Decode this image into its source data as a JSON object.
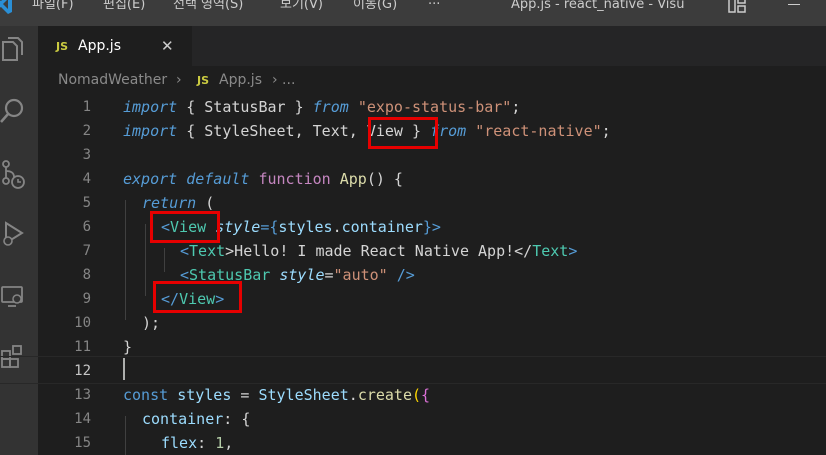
{
  "menu": {
    "items": [
      "파일(F)",
      "편집(E)",
      "선택 영역(S)",
      "보기(V)",
      "이동(G)"
    ],
    "more": "···"
  },
  "window": {
    "title": "App.js - react_native - Visu"
  },
  "tab": {
    "badge": "JS",
    "label": "App.js",
    "close": "✕"
  },
  "breadcrumb": {
    "folder": "NomadWeather",
    "sep": "›",
    "badge": "JS",
    "file": "App.js",
    "tail": "› ..."
  },
  "colors": {
    "highlight": "#e60000",
    "background": "#1e1e1e"
  },
  "lines": [
    {
      "n": "1"
    },
    {
      "n": "2"
    },
    {
      "n": "3"
    },
    {
      "n": "4"
    },
    {
      "n": "5"
    },
    {
      "n": "6"
    },
    {
      "n": "7"
    },
    {
      "n": "8"
    },
    {
      "n": "9"
    },
    {
      "n": "10"
    },
    {
      "n": "11"
    },
    {
      "n": "12"
    },
    {
      "n": "13"
    },
    {
      "n": "14"
    },
    {
      "n": "15"
    }
  ],
  "code": {
    "l1": {
      "a": "import",
      "b": " { StatusBar } ",
      "c": "from",
      "d": " ",
      "e": "\"expo-status-bar\"",
      "f": ";"
    },
    "l2": {
      "a": "import",
      "b": " { StyleSheet, Text, View } ",
      "c": "from",
      "d": " ",
      "e": "\"react-native\"",
      "f": ";"
    },
    "l4": {
      "a": "export",
      "b": " ",
      "c": "default",
      "d": " ",
      "e": "function",
      "f": " ",
      "g": "App",
      "h": "() {"
    },
    "l5": {
      "a": "return",
      "b": " ("
    },
    "l6": {
      "a": "<",
      "b": "View",
      "c": " ",
      "d": "style",
      "e": "={",
      "f": "styles",
      "g": ".",
      "h": "container",
      "i": "}>"
    },
    "l7": {
      "a": "<",
      "b": "Text",
      "c": ">Hello! I made React Native App!</",
      "d": "Text",
      "e": ">"
    },
    "l8": {
      "a": "<",
      "b": "StatusBar",
      "c": " ",
      "d": "style",
      "e": "=",
      "f": "\"auto\"",
      "g": " />"
    },
    "l9": {
      "a": "</",
      "b": "View",
      "c": ">"
    },
    "l10": {
      "a": ");"
    },
    "l11": {
      "a": "}"
    },
    "l13": {
      "a": "const",
      "b": " ",
      "c": "styles",
      "d": " = ",
      "e": "StyleSheet",
      "f": ".",
      "g": "create",
      "h": "(",
      "i": "{"
    },
    "l14": {
      "a": "container",
      "b": ": {"
    },
    "l15": {
      "a": "flex",
      "b": ": ",
      "c": "1",
      "d": ","
    }
  }
}
